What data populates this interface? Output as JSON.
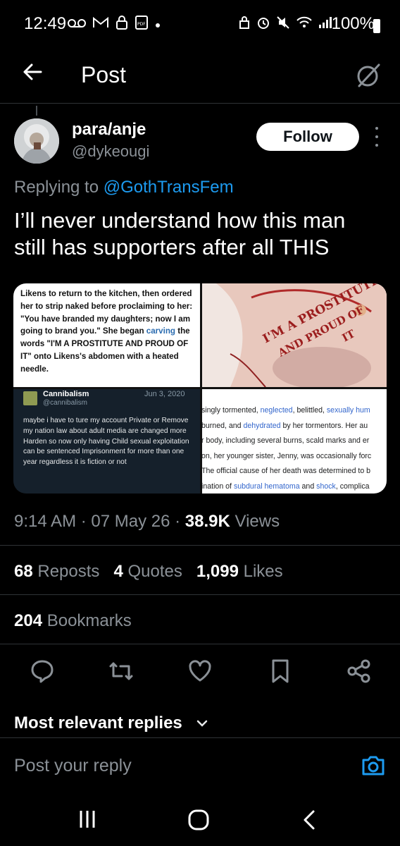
{
  "status_bar": {
    "time": "12:49",
    "battery": "100%",
    "left_icons": [
      "voicemail-icon",
      "gmail-icon",
      "lock-icon",
      "pdf-icon",
      "dot-icon"
    ],
    "right_icons": [
      "app-lock-icon",
      "alarm-icon",
      "mute-icon",
      "wifi-icon",
      "signal-icon",
      "battery-icon"
    ]
  },
  "header": {
    "title": "Post"
  },
  "tweet": {
    "author_name": "para/anje",
    "author_handle": "@dykeougi",
    "follow_label": "Follow",
    "replying_prefix": "Replying to ",
    "replying_to": "@GothTransFem",
    "text": "I’ll never understand how this man still has supporters after all THIS",
    "timestamp": "9:14 AM · 07 May 26 · ",
    "views_count": "38.9K",
    "views_label": " Views",
    "reposts_count": "68",
    "reposts_label": " Reposts",
    "quotes_count": "4",
    "quotes_label": " Quotes",
    "likes_count": "1,099",
    "likes_label": " Likes",
    "bookmarks_count": "204",
    "bookmarks_label": " Bookmarks"
  },
  "media": {
    "tile1": {
      "part1": "Likens to return to the kitchen, then ordered her to strip naked before proclaiming to her: \"You have branded my daughters; now I am going to brand you.\" She began ",
      "link": "carving",
      "part2": " the words \"I'M A PROSTITUTE AND PROUD OF IT\" onto Likens's abdomen with a heated needle."
    },
    "tile2": {
      "line1": "I'M A PROSTITUTE",
      "line2": "AND PROUD OF",
      "line3": "IT"
    },
    "tile3": {
      "account": "Cannibalism",
      "handle": "@cannibalism",
      "date": "Jun 3, 2020",
      "message_line1": "maybe i have to ture my account Private or Remove",
      "message_line2": "my nation law about adult media are changed more Harden so now only having Child sexual exploitation can be sentenced Imprisonment for more than one year regardless it is fiction or not"
    },
    "tile4": {
      "line1": [
        {
          "t": "singly tormented, ",
          "link": false
        },
        {
          "t": "neglected",
          "link": true
        },
        {
          "t": ", belittled, ",
          "link": false
        },
        {
          "t": "sexually hum",
          "link": true
        }
      ],
      "line2": [
        {
          "t": " burned, and ",
          "link": false
        },
        {
          "t": "dehydrated",
          "link": true
        },
        {
          "t": " by her tormentors. Her au",
          "link": false
        }
      ],
      "line3": [
        {
          "t": "r body, including several burns, scald marks and er",
          "link": false
        }
      ],
      "line4": [
        {
          "t": "on, her younger sister, Jenny, was occasionally forc",
          "link": false
        }
      ],
      "line5": [
        {
          "t": "The official cause of her death was determined to b",
          "link": false
        }
      ],
      "line6": [
        {
          "t": "ination of ",
          "link": false
        },
        {
          "t": "subdural hematoma",
          "link": true
        },
        {
          "t": " and ",
          "link": false
        },
        {
          "t": "shock",
          "link": true
        },
        {
          "t": ", complica",
          "link": false
        }
      ]
    }
  },
  "replies": {
    "sort_label": "Most relevant replies",
    "reply_placeholder": "Post your reply"
  },
  "colors": {
    "background": "#000000",
    "primary_text": "#e7e9ea",
    "secondary_text": "#8b9197",
    "accent": "#1d9bf0",
    "divider": "#2f3336"
  }
}
